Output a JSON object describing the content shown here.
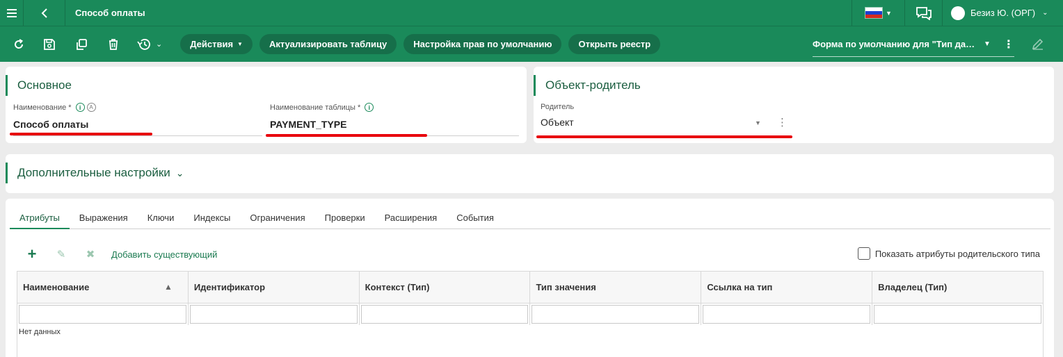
{
  "app": {
    "title": "Способ оплаты",
    "user": "Безиз Ю. (ОРГ)"
  },
  "colors": {
    "header": "#1a8a5a",
    "pill": "#166f4a",
    "accent_text": "#1b5e40",
    "annotation": "#e8000b"
  },
  "toolbar": {
    "icons": [
      "refresh-icon",
      "save-icon",
      "copy-icon",
      "delete-icon",
      "history-icon"
    ],
    "actions_label": "Действия",
    "refresh_table_label": "Актуализировать таблицу",
    "default_rights_label": "Настройка прав по умолчанию",
    "open_registry_label": "Открыть реестр",
    "form_select": "Форма по умолчанию для \"Тип данных\""
  },
  "main_card": {
    "title": "Основное",
    "name_label": "Наименование *",
    "name_value": "Способ оплаты",
    "table_label": "Наименование таблицы *",
    "table_value": "PAYMENT_TYPE"
  },
  "parent_card": {
    "title": "Объект-родитель",
    "parent_label": "Родитель",
    "parent_value": "Объект"
  },
  "additional": {
    "title": "Дополнительные настройки"
  },
  "tabs": [
    "Атрибуты",
    "Выражения",
    "Ключи",
    "Индексы",
    "Ограничения",
    "Проверки",
    "Расширения",
    "События"
  ],
  "grid": {
    "add_existing": "Добавить существующий",
    "show_parent_attrs": "Показать атрибуты родительского типа",
    "columns": [
      "Наименование",
      "Идентификатор",
      "Контекст (Тип)",
      "Тип значения",
      "Ссылка на тип",
      "Владелец (Тип)"
    ],
    "empty_text": "Нет данных"
  }
}
